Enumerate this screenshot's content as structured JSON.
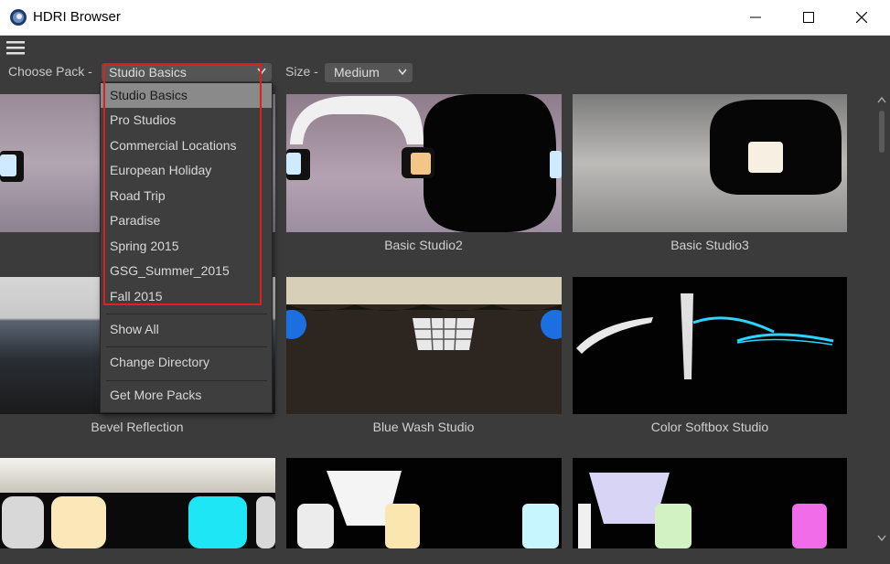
{
  "window": {
    "title": "HDRI Browser"
  },
  "toolbar": {
    "pack_label": "Choose Pack -",
    "pack_value": "Studio Basics",
    "size_label": "Size -",
    "size_value": "Medium"
  },
  "dropdown": {
    "packs": [
      "Studio Basics",
      "Pro Studios",
      "Commercial Locations",
      "European Holiday",
      "Road Trip",
      "Paradise",
      "Spring 2015",
      "GSG_Summer_2015",
      "Fall 2015"
    ],
    "actions": [
      "Show All",
      "Change Directory",
      "Get More Packs"
    ],
    "selected_index": 0
  },
  "grid": {
    "captions": [
      "",
      "Basic Studio2",
      "Basic Studio3",
      "Bevel Reflection",
      "Blue Wash Studio",
      "Color Softbox Studio"
    ]
  },
  "colors": {
    "highlight": "#e02020",
    "accent_cyan": "#2ad6ff",
    "window_bg": "#3b3b3b"
  }
}
